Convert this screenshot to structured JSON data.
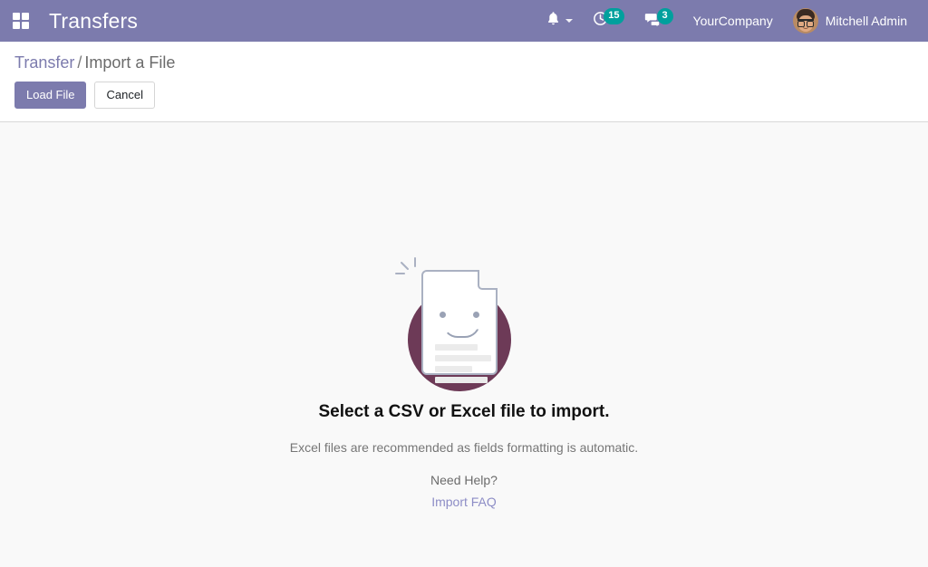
{
  "navbar": {
    "apps_icon": "apps-grid-icon",
    "brand": "Transfers",
    "bell_icon": "bell-icon",
    "activity_icon": "clock-activity-icon",
    "activity_count": "15",
    "messages_icon": "chat-bubble-icon",
    "messages_count": "3",
    "company": "YourCompany",
    "avatar_icon": "user-avatar",
    "user": "Mitchell Admin"
  },
  "control_panel": {
    "breadcrumb": {
      "parent": "Transfer",
      "separator": "/",
      "current": "Import a File"
    },
    "load_file_label": "Load File",
    "cancel_label": "Cancel"
  },
  "content": {
    "illustration_name": "smiling-document-illustration",
    "headline": "Select a CSV or Excel file to import.",
    "subtext": "Excel files are recommended as fields formatting is automatic.",
    "help_label": "Need Help?",
    "faq_link": "Import FAQ"
  },
  "colors": {
    "brand_purple": "#7c7bad",
    "badge_teal": "#00a09d",
    "link_purple": "#8d8dc6",
    "illustration_circle": "#6d3a57",
    "content_bg": "#f9f9f9"
  }
}
